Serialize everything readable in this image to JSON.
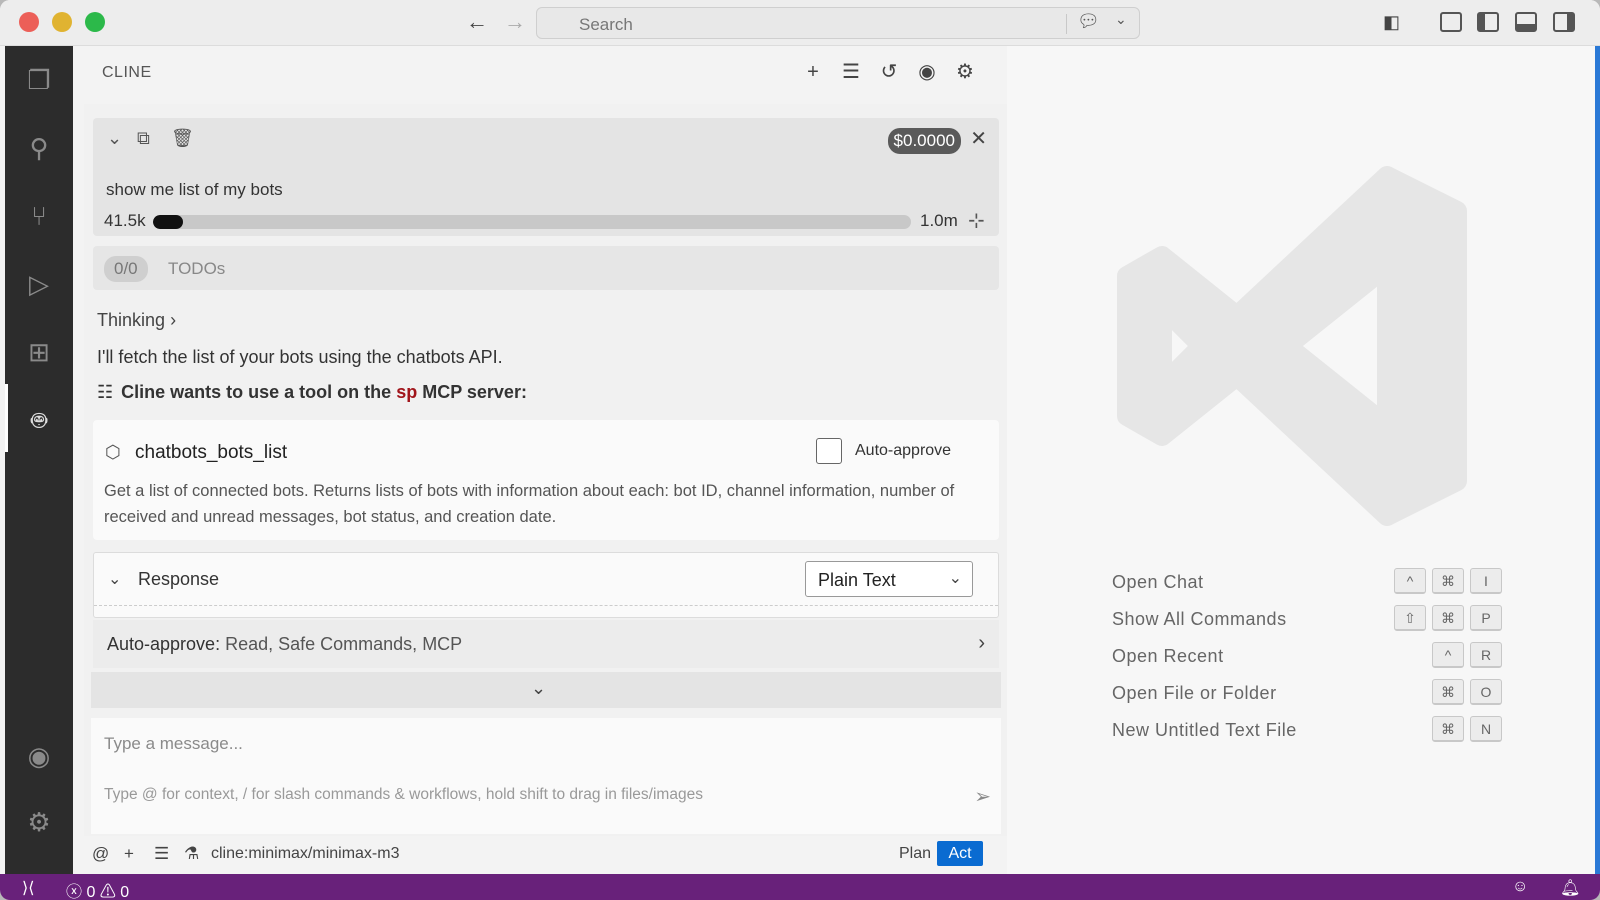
{
  "titlebar": {
    "search_placeholder": "Search",
    "back_icon": "arrow-left-icon",
    "forward_icon": "arrow-right-icon"
  },
  "activity_bar": {
    "items": [
      "explorer-icon",
      "search-icon",
      "source-control-icon",
      "run-debug-icon",
      "extensions-icon",
      "cline-bot-icon"
    ],
    "bottom_items": [
      "account-icon",
      "manage-gear-icon"
    ]
  },
  "sidebar": {
    "title": "CLINE",
    "header_icons": [
      "new-task-icon",
      "mcp-servers-icon",
      "history-icon",
      "account-icon",
      "settings-icon"
    ],
    "task": {
      "cost": "$0.0000",
      "text": "show me list of my bots",
      "context_used": "41.5k",
      "context_max": "1.0m",
      "context_fraction": 0.04
    },
    "todos": {
      "count": "0/0",
      "label": "TODOs"
    },
    "thinking_label": "Thinking",
    "message": "I'll fetch the list of your bots using the chatbots API.",
    "tool_request": {
      "prefix": "Cline wants to use a tool on the",
      "server": "sp",
      "suffix": "MCP server:"
    },
    "tool": {
      "name": "chatbots_bots_list",
      "auto_approve_label": "Auto-approve",
      "auto_approve_checked": false,
      "description": "Get a list of connected bots. Returns lists of bots with information about each: bot ID, channel information, number of received and unread messages, bot status, and creation date."
    },
    "response": {
      "label": "Response",
      "format": "Plain Text"
    },
    "auto_approve": {
      "label": "Auto-approve:",
      "value": "Read, Safe Commands, MCP"
    },
    "input": {
      "placeholder": "Type a message...",
      "hint": "Type @ for context, / for slash commands & workflows, hold shift to drag in files/images"
    },
    "footer": {
      "model": "cline:minimax/minimax-m3",
      "plan_label": "Plan",
      "act_label": "Act"
    }
  },
  "editor": {
    "shortcuts": [
      {
        "label": "Open Chat",
        "keys": [
          "^",
          "⌘",
          "I"
        ]
      },
      {
        "label": "Show All Commands",
        "keys": [
          "⇧",
          "⌘",
          "P"
        ]
      },
      {
        "label": "Open Recent",
        "keys": [
          "^",
          "R"
        ]
      },
      {
        "label": "Open File or Folder",
        "keys": [
          "⌘",
          "O"
        ]
      },
      {
        "label": "New Untitled Text File",
        "keys": [
          "⌘",
          "N"
        ]
      }
    ]
  },
  "statusbar": {
    "errors": "0",
    "warnings": "0"
  },
  "colors": {
    "statusbar": "#68217a",
    "act_button": "#0a6bd1",
    "server_name": "#a1151b"
  }
}
